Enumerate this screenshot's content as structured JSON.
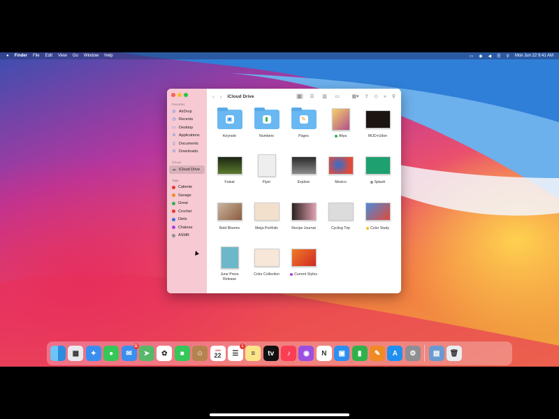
{
  "menubar": {
    "app_name": "Finder",
    "menus": [
      "File",
      "Edit",
      "View",
      "Go",
      "Window",
      "Help"
    ],
    "clock": "Mon Jun 22  9:41 AM"
  },
  "finder": {
    "title": "iCloud Drive",
    "sections": {
      "favorites": "Favorites",
      "icloud": "iCloud",
      "tags": "Tags"
    },
    "favorites": [
      "AirDrop",
      "Recents",
      "Desktop",
      "Applications",
      "Documents",
      "Downloads"
    ],
    "icloud_items": [
      "iCloud Drive"
    ],
    "tags": [
      {
        "label": "Caliente",
        "color": "#e8352f"
      },
      {
        "label": "Savage",
        "color": "#f08a24"
      },
      {
        "label": "Great",
        "color": "#2fb24c"
      },
      {
        "label": "Crochet",
        "color": "#e8352f"
      },
      {
        "label": "Diets",
        "color": "#3b6fe0"
      },
      {
        "label": "Chakras",
        "color": "#b03be0"
      },
      {
        "label": "ASMR",
        "color": "#8e8e93"
      }
    ],
    "files": [
      {
        "label": "Keynote",
        "kind": "folder",
        "glyph": "▣",
        "glyph_color": "#1f8ff0"
      },
      {
        "label": "Numbers",
        "kind": "folder",
        "glyph": "▮",
        "glyph_color": "#2fb24c"
      },
      {
        "label": "Pages",
        "kind": "folder",
        "glyph": "✎",
        "glyph_color": "#f08a24"
      },
      {
        "label": "Aliya",
        "kind": "image",
        "dot": "#2fb24c",
        "bg": "linear-gradient(135deg,#f5d06a,#b0508a)"
      },
      {
        "label": "MUD+Udon",
        "kind": "image",
        "bg": "#1b1410"
      },
      {
        "label": "Futsal",
        "kind": "image",
        "bg": "linear-gradient(180deg,#1c2614,#5c7a2c)"
      },
      {
        "label": "Flyer",
        "kind": "image",
        "bg": "#eeeeee"
      },
      {
        "label": "Explore",
        "kind": "image",
        "bg": "linear-gradient(180deg,#2a2a2a,#8a8a8a)"
      },
      {
        "label": "Mexico",
        "kind": "image",
        "bg": "radial-gradient(circle at 40% 45%,#2f6fd0,#e24a3a 70%)"
      },
      {
        "label": "Splash",
        "kind": "image",
        "dot": "#8e8e93",
        "bg": "#1ea070"
      },
      {
        "label": "Bold Blooms",
        "kind": "image",
        "bg": "linear-gradient(135deg,#c9b5a0,#8a5c3c)"
      },
      {
        "label": "Meija Portfolio",
        "kind": "image",
        "bg": "#f2e0cc"
      },
      {
        "label": "Recipe Journal",
        "kind": "image",
        "bg": "linear-gradient(90deg,#2a2020,#e0a0b0)"
      },
      {
        "label": "Cycling Trip",
        "kind": "image",
        "bg": "#dcdcdc"
      },
      {
        "label": "Color Study",
        "kind": "image",
        "dot": "#f0c020",
        "bg": "linear-gradient(135deg,#4a8ad8,#e04a3a)"
      },
      {
        "label": "June Press Release",
        "kind": "image",
        "bg": "#6cb8c8"
      },
      {
        "label": "Color Collection",
        "kind": "image",
        "bg": "#f7e7d8"
      },
      {
        "label": "Current Styles",
        "kind": "image",
        "dot": "#b03be0",
        "bg": "linear-gradient(135deg,#f07a2a,#d02a20)"
      }
    ]
  },
  "dock": {
    "apps": [
      {
        "name": "finder-icon",
        "bg": "linear-gradient(90deg,#6ec4f5 50%,#2b8de0 50%)",
        "glyph": ""
      },
      {
        "name": "launchpad-icon",
        "bg": "#e9e9ee",
        "glyph": "▦"
      },
      {
        "name": "safari-icon",
        "bg": "#3a8ef0",
        "glyph": "✦"
      },
      {
        "name": "messages-icon",
        "bg": "#35c759",
        "glyph": "●"
      },
      {
        "name": "mail-icon",
        "bg": "#3a8ef0",
        "glyph": "✉",
        "badge": "11"
      },
      {
        "name": "maps-icon",
        "bg": "#58b86a",
        "glyph": "➤"
      },
      {
        "name": "photos-icon",
        "bg": "#ffffff",
        "glyph": "✿"
      },
      {
        "name": "facetime-icon",
        "bg": "#35c759",
        "glyph": "■"
      },
      {
        "name": "contacts-icon",
        "bg": "#b5844e",
        "glyph": "☺"
      },
      {
        "name": "calendar-icon",
        "bg": "#ffffff",
        "glyph": "22",
        "label": "JUN"
      },
      {
        "name": "reminders-icon",
        "bg": "#ffffff",
        "glyph": "☰",
        "badge": "1"
      },
      {
        "name": "notes-icon",
        "bg": "#fbe48a",
        "glyph": "≡"
      },
      {
        "name": "tv-icon",
        "bg": "#111111",
        "glyph": "tv"
      },
      {
        "name": "music-icon",
        "bg": "#fa3e55",
        "glyph": "♪"
      },
      {
        "name": "podcasts-icon",
        "bg": "#9b4fe0",
        "glyph": "◉"
      },
      {
        "name": "news-icon",
        "bg": "#ffffff",
        "glyph": "N"
      },
      {
        "name": "keynote-icon",
        "bg": "#2c8ff0",
        "glyph": "▣"
      },
      {
        "name": "numbers-icon",
        "bg": "#2fb24c",
        "glyph": "▮"
      },
      {
        "name": "pages-icon",
        "bg": "#f08a24",
        "glyph": "✎"
      },
      {
        "name": "app-store-icon",
        "bg": "#1f8ff0",
        "glyph": "A"
      },
      {
        "name": "system-preferences-icon",
        "bg": "#8e8e93",
        "glyph": "⚙"
      }
    ],
    "docs": [
      {
        "name": "downloads-stack-icon",
        "bg": "#6a9ad0",
        "glyph": "▤"
      },
      {
        "name": "trash-icon",
        "bg": "#e9edf2",
        "glyph": "🗑"
      }
    ]
  }
}
